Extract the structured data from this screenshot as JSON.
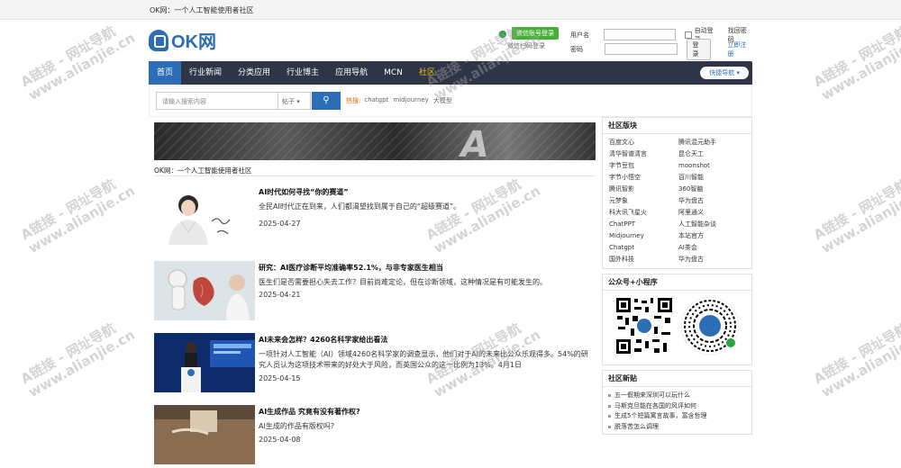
{
  "top_bar": {
    "title": "OK网：一个人工智能使用者社区"
  },
  "header": {
    "logo_text": "OK网",
    "wechat_login_label": "微信账号登录",
    "wechat_login_sub": "微信扫码登录",
    "username_label": "用户名",
    "password_label": "密码",
    "remember_label": "自动登录",
    "forgot_label": "找回密码",
    "login_button": "登录",
    "register_link": "立即注册"
  },
  "nav": {
    "items": [
      "首页",
      "行业新闻",
      "分类应用",
      "行业博主",
      "应用导航",
      "MCN",
      "社区"
    ],
    "quick_nav": "快捷导航 ▾"
  },
  "search": {
    "placeholder": "请输入搜索内容",
    "type": "帖子 ▾",
    "hot_label": "热搜:",
    "hot_items": [
      "chatgpt",
      "midjourney",
      "大模型"
    ]
  },
  "main": {
    "banner_caption": "OK网：一个人工智能使用者社区",
    "articles": [
      {
        "title": "AI时代如何寻找“你的赛道”",
        "desc": "全民AI时代正在到来，人们都渴望找到属于自己的“超级赛道”。",
        "date": "2025-04-27"
      },
      {
        "title": "研究：AI医疗诊断平均准确率52.1%，与非专家医生相当",
        "desc": "医生们是否需要担心失去工作？目前尚难定论，但在诊断领域，这种情况是有可能发生的。",
        "date": "2025-04-21"
      },
      {
        "title": "AI未来会怎样？4260名科学家给出看法",
        "desc": "一项针对人工智能（AI）领域4260名科学家的调查显示，他们对于AI的未来比公众乐观得多。54%的研究人员认为这项技术带来的好处大于风险，而英国公众的这一比例为13%。4月1日",
        "date": "2025-04-15"
      },
      {
        "title": "AI生成作品 究竟有没有著作权?",
        "desc": "AI生成的作品有版权吗?",
        "date": "2025-04-08"
      }
    ]
  },
  "sidebar": {
    "community_title": "社区版块",
    "community_links": [
      "百度文心",
      "腾讯混元助手",
      "清华智谱清言",
      "昆仑天工",
      "字节豆包",
      "moonshot",
      "字节小悟空",
      "百川智能",
      "腾讯智影",
      "360智脑",
      "元梦象",
      "华为盘古",
      "科大讯飞星火",
      "阿里通义",
      "ChatPPT",
      "人工智能杂谈",
      "Midjourney",
      "本站官方",
      "Chatgpt",
      "AI茶会",
      "国外科技",
      "华为盘古"
    ],
    "qr_title": "公众号+小程序",
    "news_title": "社区新贴",
    "news_items": [
      "五一假期来深圳可以玩什么",
      "马斯克旦能在各国的风评如何",
      "生成5个短篇寓言故事，富含哲理",
      "脱落苦怎么调理"
    ]
  },
  "watermark": "A链接 - 网址导航 www.alianjie.cn",
  "colors": {
    "brand_blue": "#2d6db5",
    "nav_dark": "#2f3447",
    "hot_orange": "#e8690c",
    "wechat_green": "#45b035"
  }
}
